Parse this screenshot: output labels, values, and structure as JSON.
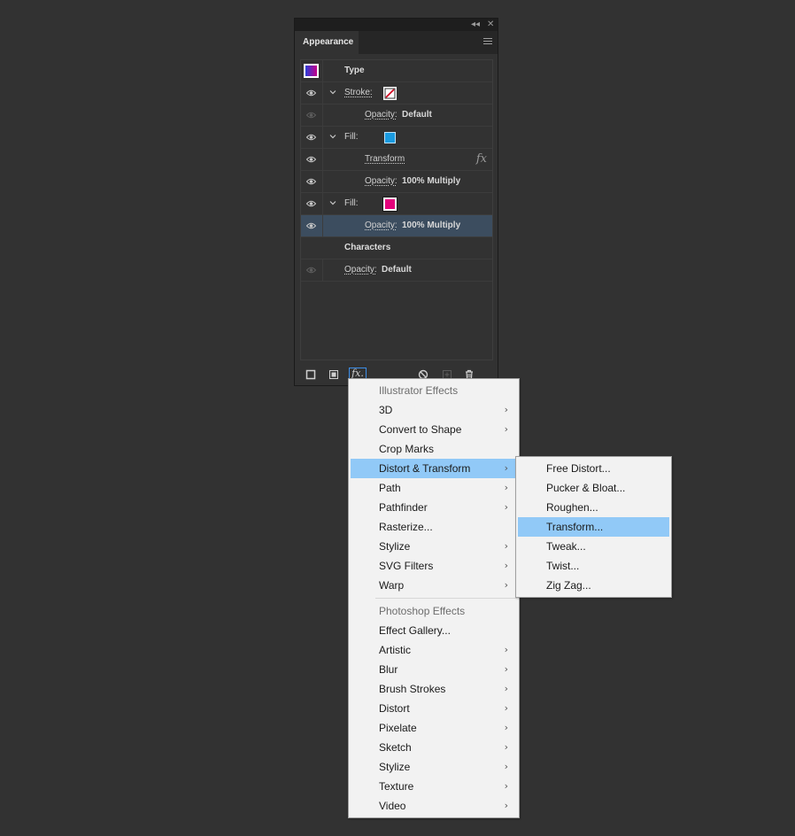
{
  "panel": {
    "tab_label": "Appearance",
    "collapse_glyph": "◂◂",
    "close_glyph": "✕",
    "rows": [
      {
        "label": "Type"
      },
      {
        "label": "Stroke:"
      },
      {
        "label": "Opacity:",
        "value": "Default"
      },
      {
        "label": "Fill:"
      },
      {
        "label": "Transform",
        "fx": "fx"
      },
      {
        "label": "Opacity:",
        "value": "100% Multiply"
      },
      {
        "label": "Fill:"
      },
      {
        "label": "Opacity:",
        "value": "100% Multiply"
      },
      {
        "label": "Characters"
      },
      {
        "label": "Opacity:",
        "value": "Default"
      }
    ],
    "footer_fx": "fx.",
    "colors": {
      "fill_cyan": "#1a9be0",
      "fill_magenta": "#e3007b",
      "stroke_red": "#d0021b",
      "selection": "#3c4d5f"
    }
  },
  "effects_menu": {
    "sections": [
      {
        "header": "Illustrator Effects",
        "items": [
          {
            "label": "3D",
            "sub": true
          },
          {
            "label": "Convert to Shape",
            "sub": true
          },
          {
            "label": "Crop Marks",
            "sub": false
          },
          {
            "label": "Distort & Transform",
            "sub": true
          },
          {
            "label": "Path",
            "sub": true
          },
          {
            "label": "Pathfinder",
            "sub": true
          },
          {
            "label": "Rasterize...",
            "sub": false
          },
          {
            "label": "Stylize",
            "sub": true
          },
          {
            "label": "SVG Filters",
            "sub": true
          },
          {
            "label": "Warp",
            "sub": true
          }
        ]
      },
      {
        "header": "Photoshop Effects",
        "items": [
          {
            "label": "Effect Gallery...",
            "sub": false
          },
          {
            "label": "Artistic",
            "sub": true
          },
          {
            "label": "Blur",
            "sub": true
          },
          {
            "label": "Brush Strokes",
            "sub": true
          },
          {
            "label": "Distort",
            "sub": true
          },
          {
            "label": "Pixelate",
            "sub": true
          },
          {
            "label": "Sketch",
            "sub": true
          },
          {
            "label": "Stylize",
            "sub": true
          },
          {
            "label": "Texture",
            "sub": true
          },
          {
            "label": "Video",
            "sub": true
          }
        ]
      }
    ],
    "submenu_arrow": "›"
  },
  "distort_submenu": {
    "items": [
      "Free Distort...",
      "Pucker & Bloat...",
      "Roughen...",
      "Transform...",
      "Tweak...",
      "Twist...",
      "Zig Zag..."
    ]
  }
}
